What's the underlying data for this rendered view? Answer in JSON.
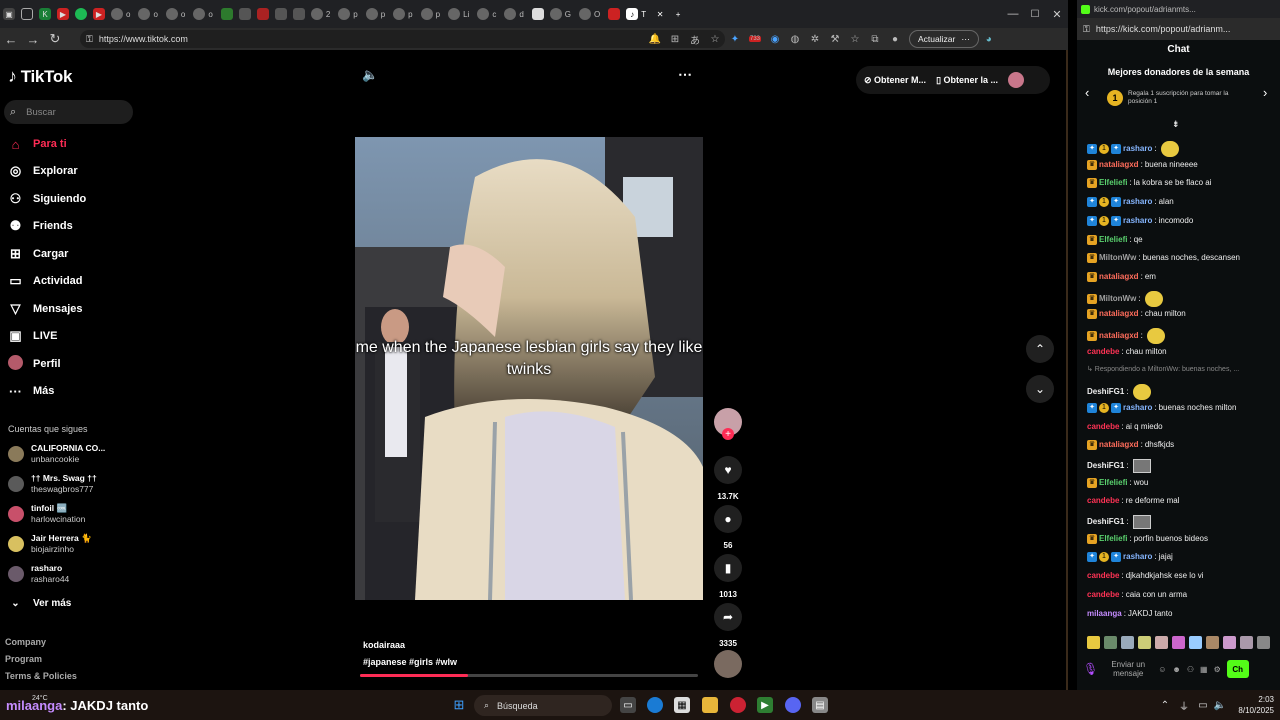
{
  "left_window": {
    "url": "https://www.tiktok.com",
    "update_label": "Actualizar",
    "tab_labels": [
      "o",
      "o",
      "o",
      "o",
      "o",
      "o",
      "2",
      "p",
      "p",
      "p",
      "p",
      "Li",
      "c",
      "d",
      "G",
      "O",
      "T"
    ],
    "extension_badge": "733"
  },
  "tiktok": {
    "logo": "TikTok",
    "search_placeholder": "Buscar",
    "nav": [
      {
        "label": "Para ti",
        "icon": "home-icon",
        "active": true
      },
      {
        "label": "Explorar",
        "icon": "compass-icon"
      },
      {
        "label": "Siguiendo",
        "icon": "following-icon"
      },
      {
        "label": "Friends",
        "icon": "friends-icon"
      },
      {
        "label": "Cargar",
        "icon": "upload-icon"
      },
      {
        "label": "Actividad",
        "icon": "activity-icon"
      },
      {
        "label": "Mensajes",
        "icon": "messages-icon"
      },
      {
        "label": "LIVE",
        "icon": "live-icon"
      },
      {
        "label": "Perfil",
        "icon": "profile-avatar"
      },
      {
        "label": "Más",
        "icon": "more-icon"
      }
    ],
    "following_title": "Cuentas que sigues",
    "accounts": [
      {
        "name": "CALIFORNIA CO...",
        "handle": "unbancookie"
      },
      {
        "name": "†† Mrs. Swag ††",
        "handle": "theswagbros777"
      },
      {
        "name": "tinfoil 🆒",
        "handle": "harlowcination"
      },
      {
        "name": "Jair Herrera 🐈",
        "handle": "biojairzinho"
      },
      {
        "name": "rasharo",
        "handle": "rasharo44"
      }
    ],
    "see_more": "Ver más",
    "footer": [
      "Company",
      "Program",
      "Terms & Policies"
    ],
    "pill": {
      "item1": "Obtener M...",
      "item2": "Obtener la ..."
    },
    "video": {
      "caption": "me when the Japanese lesbian girls say they like twinks",
      "author": "kodairaaa",
      "tags": "#japanese #girls #wlw",
      "progress": 0.32
    },
    "actions": {
      "likes": "13.7K",
      "comments": "56",
      "saves": "1013",
      "shares": "3335"
    }
  },
  "kick": {
    "tab_label": "kick.com/popout/adrianmts...",
    "url": "https://kick.com/popout/adrianm...",
    "chat_title": "Chat",
    "donors_title": "Mejores donadores de la semana",
    "donor_cta": "Regala 1 suscripción para tomar la posición 1",
    "donor_rank": "1",
    "messages": [
      {
        "user": "rasharo",
        "color": "#86b6ff",
        "badges": [
          "b-blue",
          "b-coin",
          "b-blue"
        ],
        "text": "",
        "emote": "emote"
      },
      {
        "user": "nataliagxd",
        "color": "#ff6d5c",
        "badges": [
          "b-gold"
        ],
        "text": "buena nineeee"
      },
      {
        "user": "Elfeliefi",
        "color": "#5ad16e",
        "badges": [
          "b-gold"
        ],
        "text": "la kobra se be flaco ai"
      },
      {
        "user": "rasharo",
        "color": "#86b6ff",
        "badges": [
          "b-blue",
          "b-coin",
          "b-blue"
        ],
        "text": "alan"
      },
      {
        "user": "rasharo",
        "color": "#86b6ff",
        "badges": [
          "b-blue",
          "b-coin",
          "b-blue"
        ],
        "text": "incomodo"
      },
      {
        "user": "Elfeliefi",
        "color": "#5ad16e",
        "badges": [
          "b-gold"
        ],
        "text": "qe"
      },
      {
        "user": "MiltonWw",
        "color": "#a0a0a0",
        "badges": [
          "b-gold"
        ],
        "text": "buenas noches, descansen"
      },
      {
        "user": "nataliagxd",
        "color": "#ff6d5c",
        "badges": [
          "b-gold"
        ],
        "text": "em"
      },
      {
        "user": "MiltonWw",
        "color": "#a0a0a0",
        "badges": [
          "b-gold"
        ],
        "text": "",
        "emote": "emote"
      },
      {
        "user": "nataliagxd",
        "color": "#ff6d5c",
        "badges": [
          "b-gold"
        ],
        "text": "chau milton"
      },
      {
        "user": "nataliagxd",
        "color": "#ff6d5c",
        "badges": [
          "b-gold"
        ],
        "text": "",
        "emote": "emote"
      },
      {
        "user": "candebe",
        "color": "#ff3355",
        "badges": [],
        "text": "chau milton"
      },
      {
        "user": "",
        "color": "#888",
        "badges": [],
        "text": "↳ Respondiendo a MiltonWw: buenas noches, ...",
        "reply": true
      },
      {
        "user": "DeshiFG1",
        "color": "#eeeeee",
        "badges": [],
        "text": "",
        "emote": "emote"
      },
      {
        "user": "rasharo",
        "color": "#86b6ff",
        "badges": [
          "b-blue",
          "b-coin",
          "b-blue"
        ],
        "text": "buenas noches milton"
      },
      {
        "user": "candebe",
        "color": "#ff3355",
        "badges": [],
        "text": "ai q miedo"
      },
      {
        "user": "nataliagxd",
        "color": "#ff6d5c",
        "badges": [
          "b-gold"
        ],
        "text": "dhsfkjds"
      },
      {
        "user": "DeshiFG1",
        "color": "#eeeeee",
        "badges": [],
        "text": "",
        "emote": "thumb"
      },
      {
        "user": "Elfeliefi",
        "color": "#5ad16e",
        "badges": [
          "b-gold"
        ],
        "text": "wou"
      },
      {
        "user": "candebe",
        "color": "#ff3355",
        "badges": [],
        "text": "re deforme mal"
      },
      {
        "user": "DeshiFG1",
        "color": "#eeeeee",
        "badges": [],
        "text": "",
        "emote": "thumb"
      },
      {
        "user": "Elfeliefi",
        "color": "#5ad16e",
        "badges": [
          "b-gold"
        ],
        "text": "porfin buenos bideos"
      },
      {
        "user": "rasharo",
        "color": "#86b6ff",
        "badges": [
          "b-blue",
          "b-coin",
          "b-blue"
        ],
        "text": "jajaj"
      },
      {
        "user": "candebe",
        "color": "#ff3355",
        "badges": [],
        "text": "djkahdkjahsk ese lo vi"
      },
      {
        "user": "candebe",
        "color": "#ff3355",
        "badges": [],
        "text": "caia con un arma"
      },
      {
        "user": "milaanga",
        "color": "#c58cff",
        "badges": [],
        "text": "JAKDJ tanto"
      }
    ],
    "input_placeholder": "Enviar un mensaje",
    "send_label": "Ch"
  },
  "taskbar": {
    "overlay_user": "milaanga",
    "overlay_text": ": JAKDJ tanto",
    "weather": "24°C",
    "search_label": "Búsqueda",
    "time": "2:03",
    "date": "8/10/2025"
  },
  "colors": {
    "tiktok_accent": "#fe2c55",
    "kick_green": "#53fc18"
  }
}
